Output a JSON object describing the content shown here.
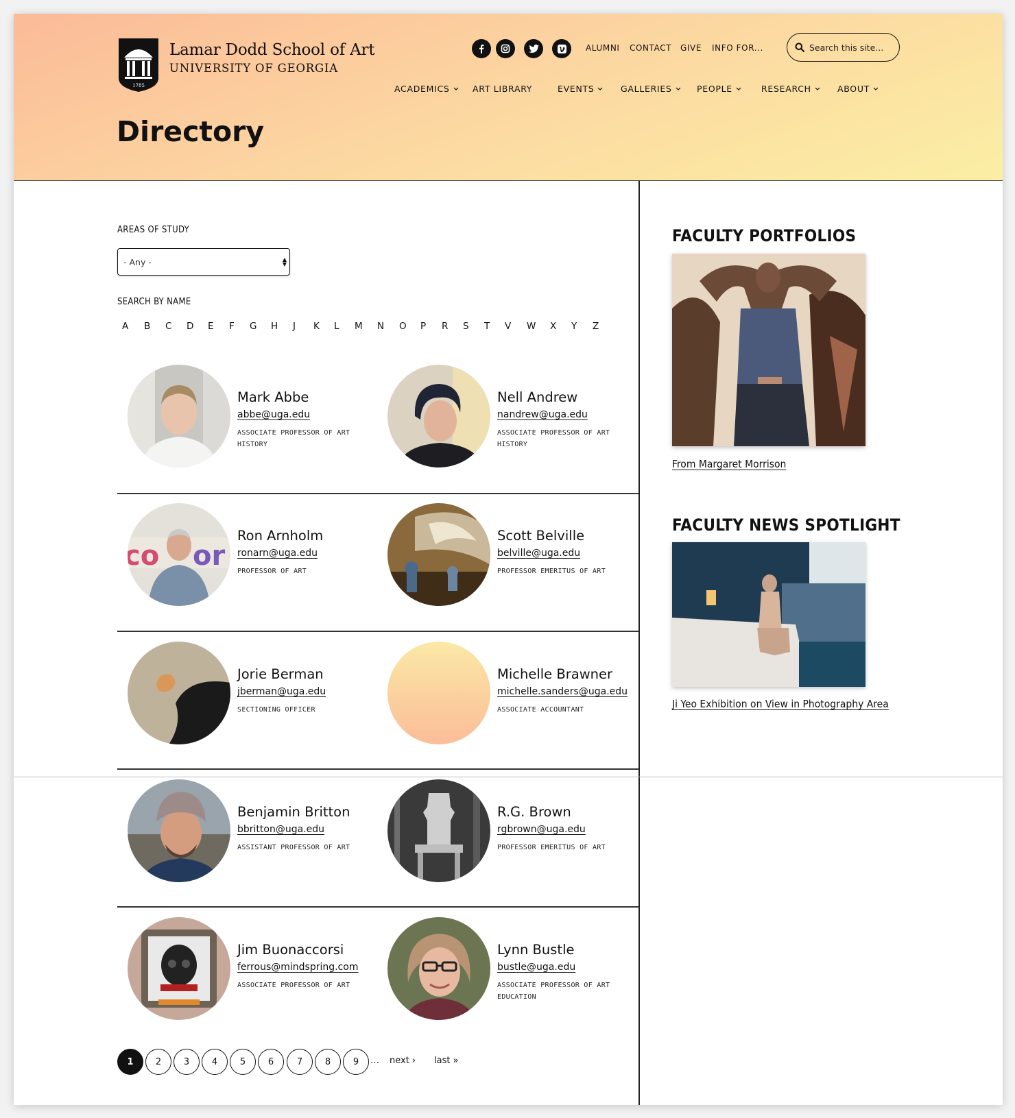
{
  "brand": {
    "title": "Lamar Dodd School of Art",
    "subtitle": "UNIVERSITY OF GEORGIA",
    "seal_year": "1785"
  },
  "social_icons": [
    "facebook-icon",
    "instagram-icon",
    "twitter-icon",
    "vimeo-icon"
  ],
  "utility_links": [
    "ALUMNI",
    "CONTACT",
    "GIVE",
    "INFO FOR..."
  ],
  "search": {
    "placeholder": "Search this site..."
  },
  "nav": [
    {
      "label": "ACADEMICS",
      "dropdown": true
    },
    {
      "label": "ART LIBRARY",
      "dropdown": false
    },
    {
      "label": "EVENTS",
      "dropdown": true
    },
    {
      "label": "GALLERIES",
      "dropdown": true
    },
    {
      "label": "PEOPLE",
      "dropdown": true
    },
    {
      "label": "RESEARCH",
      "dropdown": true
    },
    {
      "label": "ABOUT",
      "dropdown": true
    }
  ],
  "page_title": "Directory",
  "filters": {
    "areas_label": "AREAS OF STUDY",
    "areas_value": "- Any -",
    "search_label": "SEARCH BY NAME",
    "letters": [
      "A",
      "B",
      "C",
      "D",
      "E",
      "F",
      "G",
      "H",
      "J",
      "K",
      "L",
      "M",
      "N",
      "O",
      "P",
      "R",
      "S",
      "T",
      "V",
      "W",
      "X",
      "Y",
      "Z"
    ]
  },
  "people": [
    {
      "name": "Mark Abbe",
      "email": "abbe@uga.edu",
      "title": "ASSOCIATE PROFESSOR OF ART HISTORY"
    },
    {
      "name": "Nell Andrew",
      "email": "nandrew@uga.edu",
      "title": "ASSOCIATE PROFESSOR OF ART HISTORY"
    },
    {
      "name": "Ron Arnholm",
      "email": "ronarn@uga.edu",
      "title": "PROFESSOR OF ART"
    },
    {
      "name": "Scott Belville",
      "email": "belville@uga.edu",
      "title": "PROFESSOR EMERITUS OF ART"
    },
    {
      "name": "Jorie Berman",
      "email": "jberman@uga.edu",
      "title": "SECTIONING OFFICER"
    },
    {
      "name": "Michelle Brawner",
      "email": "michelle.sanders@uga.edu",
      "title": "ASSOCIATE ACCOUNTANT"
    },
    {
      "name": "Benjamin Britton",
      "email": "bbritton@uga.edu",
      "title": "ASSISTANT PROFESSOR OF ART"
    },
    {
      "name": "R.G. Brown",
      "email": "rgbrown@uga.edu",
      "title": "PROFESSOR EMERITUS OF ART"
    },
    {
      "name": "Jim Buonaccorsi",
      "email": "ferrous@mindspring.com",
      "title": "ASSOCIATE PROFESSOR OF ART"
    },
    {
      "name": "Lynn Bustle",
      "email": "bustle@uga.edu",
      "title": "ASSOCIATE PROFESSOR OF ART EDUCATION"
    }
  ],
  "pager": {
    "pages": [
      "1",
      "2",
      "3",
      "4",
      "5",
      "6",
      "7",
      "8",
      "9"
    ],
    "current": "1",
    "ellipsis": "…",
    "next": "next ›",
    "last": "last »"
  },
  "sidebar": {
    "portfolios_heading": "FACULTY PORTFOLIOS",
    "portfolios_link": "From Margaret Morrison",
    "news_heading": "FACULTY NEWS SPOTLIGHT",
    "news_link": "Ji Yeo Exhibition on View in Photography Area"
  }
}
